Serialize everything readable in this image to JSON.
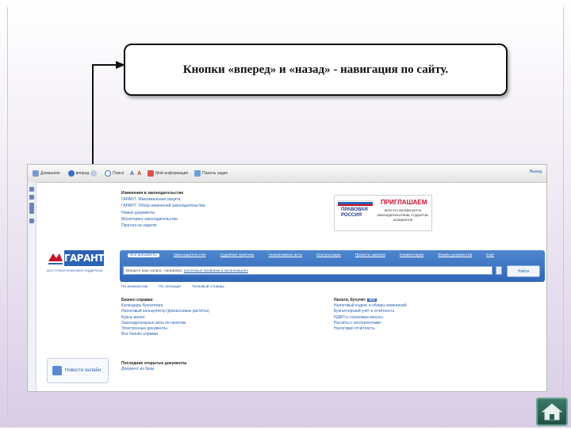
{
  "callout": {
    "text": "Кнопки «вперед» и «назад» - навигация по сайту."
  },
  "toolbar": {
    "home_label": "Домашняя",
    "next_label": "вперед",
    "search_label": "Поиск",
    "info_label": "Мой информация",
    "panel_label": "Панель задач",
    "exit_label": "Выход"
  },
  "changes": {
    "title": "Изменения в законодательстве",
    "items": [
      "ГАРАНТ: Максимальная защита",
      "ГАРАНТ: Обзор изменений законодательства",
      "Новые документы",
      "Мониторинг законодательства",
      "Прогноз на неделю"
    ]
  },
  "banner": {
    "pravo": "ПРАВОВАЯ РОССИЯ",
    "headline": "ПРИГЛАШАЕМ",
    "sub": "всех кто интересуется законодательством, студентов, аспирантов"
  },
  "logo": {
    "word": "ГАРАНТ",
    "tagline": "ДОСТУПНАЯ ПРАВОВАЯ ПОДДЕРЖКА"
  },
  "search": {
    "tabs": [
      "Все документы",
      "Законодательство",
      "Судебная практика",
      "Нормативные акты",
      "Консультации",
      "Проекты законов",
      "Комментарии",
      "Формы документов",
      "Ещё"
    ],
    "placeholder": "Введите ваш запрос, например:",
    "example": "налоговые проверки в организациях",
    "button": "Найти"
  },
  "options": [
    "По реквизитам",
    "По ситуации",
    "Толковый словарь"
  ],
  "left_col": {
    "title": "Бизнес-справки",
    "items": [
      "Календарь бухгалтера",
      "Налоговый калькулятор (финансовые расчёты)",
      "Курсы валют",
      "Законодательные акты по налогам",
      "Электронные документы",
      "Все бизнес-справки"
    ]
  },
  "right_col": {
    "title": "Налоги, бухучёт",
    "badge": "NEW",
    "items": [
      "Налоговый кодекс и обзоры изменений",
      "Бухгалтерский учёт и отчётность",
      "НДФЛ и страховые взносы",
      "Расчёты с контрагентами",
      "Налоговая отчётность"
    ]
  },
  "recent": {
    "title": "Последние открытые документы",
    "items": [
      "Документ из базы"
    ]
  },
  "news_button": {
    "label": "Новости онлайн"
  }
}
